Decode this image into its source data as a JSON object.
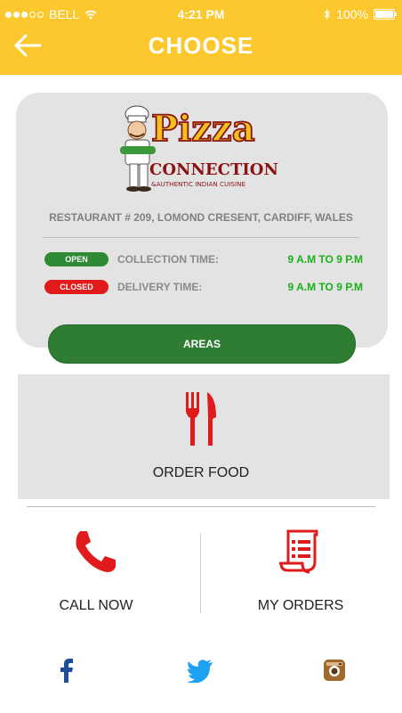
{
  "status_bar": {
    "carrier": "BELL",
    "time": "4:21 PM",
    "battery": "100%"
  },
  "header": {
    "title": "CHOOSE",
    "back_icon": "back-arrow-icon"
  },
  "restaurant": {
    "logo_text": "Pizza",
    "logo_text_2": "CONNECTION",
    "logo_text_3": "&AUTHENTIC INDIAN CUISINE",
    "address": "RESTAURANT # 209, LOMOND CRESENT, CARDIFF, WALES",
    "collection": {
      "status": "OPEN",
      "label": "COLLECTION TIME:",
      "hours": "9 A.M TO 9 P.M"
    },
    "delivery": {
      "status": "CLOSED",
      "label": "DELIVERY TIME:",
      "hours": "9 A.M TO 9 P.M"
    }
  },
  "areas_button": "AREAS",
  "order_food": {
    "label": "ORDER FOOD",
    "icon": "fork-knife-icon"
  },
  "call_now": {
    "label": "CALL NOW",
    "icon": "phone-icon"
  },
  "my_orders": {
    "label": "MY ORDERS",
    "icon": "receipt-icon"
  },
  "social": {
    "facebook_icon": "facebook-icon",
    "twitter_icon": "twitter-icon",
    "instagram_icon": "instagram-icon"
  },
  "colors": {
    "header": "#fdc82d",
    "open": "#2e8a35",
    "closed": "#e11b1b",
    "hours": "#19b119",
    "accent_red": "#e11b1b"
  }
}
